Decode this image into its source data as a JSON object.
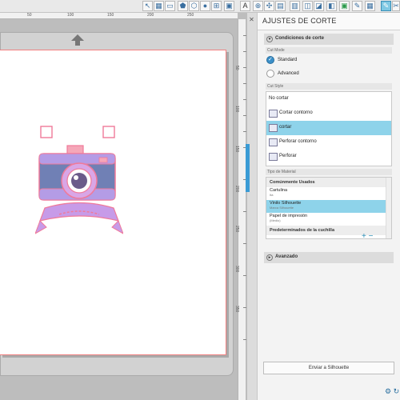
{
  "toolbar": {
    "buttons": [
      "cursor-icon",
      "grid-icon",
      "panel-icon",
      "pentagon-icon",
      "hexagon-icon",
      "circle-icon",
      "line-icon",
      "text-icon",
      "align-icon",
      "move-icon",
      "layers-icon",
      "replicate-icon",
      "offset-icon",
      "trace-icon",
      "store-icon",
      "cut-settings-icon",
      "send-icon"
    ]
  },
  "ruler": {
    "top_ticks": [
      "0",
      "50",
      "100",
      "150",
      "200",
      "250"
    ],
    "side_ticks": [
      "50",
      "100",
      "150",
      "200",
      "250",
      "300",
      "350"
    ]
  },
  "panel": {
    "title": "AJUSTES DE CORTE",
    "close": "✕",
    "conditions_header": "Condiciones de corte",
    "cut_mode_label": "Cut Mode",
    "modes": [
      "Standard",
      "Advanced"
    ],
    "cut_style_label": "Cut Style",
    "styles": [
      "No cortar",
      "Cortar contorno",
      "cortar",
      "Perforar contorno",
      "Perforar"
    ],
    "material_label": "Tipo de Material",
    "material_group": "Comúnmente Usados",
    "materials": [
      {
        "name": "Cartulina",
        "sub": "Ita"
      },
      {
        "name": "Vinilo Silhouette",
        "sub": "Marca Silhouette"
      },
      {
        "name": "Papel de impresión",
        "sub": "(Medio)"
      }
    ],
    "blade_presets": "Predeterminados de la cuchilla",
    "add": "+",
    "remove": "−",
    "advanced_header": "Avanzado",
    "send_button": "Enviar a Silhouette"
  },
  "colors": {
    "accent": "#3a9bd5",
    "selected": "#8ed3ea",
    "camera_body": "#6f7fb0",
    "camera_pink": "#f07a9a",
    "banner": "#c79be8"
  }
}
